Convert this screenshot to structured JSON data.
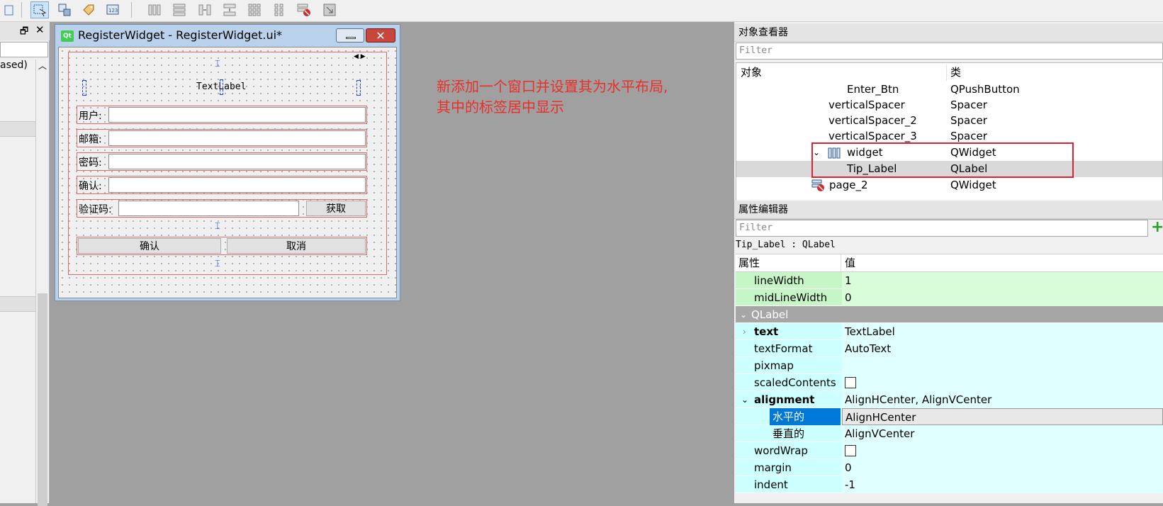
{
  "form_window": {
    "title": "RegisterWidget - RegisterWidget.ui*",
    "qt_badge": "Qt",
    "text_label": "TextLabel",
    "fields": [
      {
        "label": "用户:"
      },
      {
        "label": "邮箱:"
      },
      {
        "label": "密码:"
      },
      {
        "label": "确认:"
      }
    ],
    "captcha_label": "验证码:",
    "get_button": "获取",
    "confirm_button": "确认",
    "cancel_button": "取消"
  },
  "left_dock": {
    "partial_text": "ased)"
  },
  "annotation": {
    "line1": "新添加一个窗口并设置其为水平布局,",
    "line2": "其中的标签居中显示"
  },
  "object_inspector": {
    "title": "对象查看器",
    "filter_placeholder": "Filter",
    "col_object": "对象",
    "col_class": "类",
    "rows": [
      {
        "name": "Enter_Btn",
        "class": "QPushButton"
      },
      {
        "name": "verticalSpacer",
        "class": "Spacer"
      },
      {
        "name": "verticalSpacer_2",
        "class": "Spacer"
      },
      {
        "name": "verticalSpacer_3",
        "class": "Spacer"
      },
      {
        "name": "widget",
        "class": "QWidget"
      },
      {
        "name": "Tip_Label",
        "class": "QLabel"
      },
      {
        "name": "page_2",
        "class": "QWidget"
      }
    ]
  },
  "property_editor": {
    "title": "属性编辑器",
    "filter_placeholder": "Filter",
    "object_caption": "Tip_Label : QLabel",
    "col_property": "属性",
    "col_value": "值",
    "rows": [
      {
        "name": "lineWidth",
        "value": "1"
      },
      {
        "name": "midLineWidth",
        "value": "0"
      },
      {
        "name": "QLabel",
        "value": ""
      },
      {
        "name": "text",
        "value": "TextLabel"
      },
      {
        "name": "textFormat",
        "value": "AutoText"
      },
      {
        "name": "pixmap",
        "value": ""
      },
      {
        "name": "scaledContents",
        "value": ""
      },
      {
        "name": "alignment",
        "value": "AlignHCenter, AlignVCenter"
      },
      {
        "name": "水平的",
        "value": "AlignHCenter"
      },
      {
        "name": "垂直的",
        "value": "AlignVCenter"
      },
      {
        "name": "wordWrap",
        "value": ""
      },
      {
        "name": "margin",
        "value": "0"
      },
      {
        "name": "indent",
        "value": "-1"
      }
    ]
  },
  "colors": {
    "annotation_red": "#e8302a",
    "highlight_box": "#e0202a",
    "selection_blue": "#0078d7",
    "prop_green": "#c6f5c6",
    "prop_cyan": "#ccffff",
    "group_gray": "#a6a6a6"
  }
}
